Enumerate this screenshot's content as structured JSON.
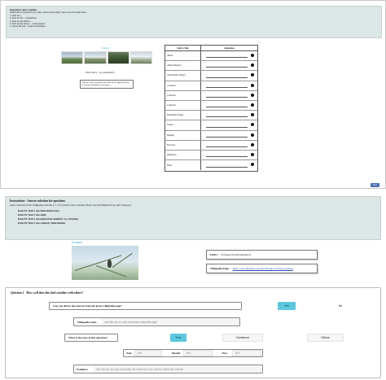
{
  "top": {
    "instr_title": "Instructions: select a question",
    "instr_sub": "Which kind of question do you want to ask about the entity? Select one of the Tasks below.",
    "instr_items": [
      "1. Don't use ...",
      "2. Don't use the ... visualization",
      "3. Don't use the infobox ...",
      "4. Don't use the answer ... at this question",
      "5. Choose the task ... based on the images ..."
    ],
    "gallery_label": "Gallery",
    "caption": "What is this a ... (Lowlands Bird) ...",
    "note": "Pick one of the questions in the table on the right and answer it with the information on the page ...",
    "table_head": [
      "Select a Task",
      "Annotation"
    ],
    "tasks": [
      "Album",
      "Album Subgenre",
      "Characteristic (Stage)",
      "Calculator",
      "Collection",
      "Collection",
      "Established (Stage)",
      "Gender",
      "Heading",
      "First Area",
      "Dimension",
      "Home"
    ],
    "next_label": "Next"
  },
  "bottom": {
    "instr_title": "Instructions - Answer selection for questions",
    "instr_sub": "select answers from Wikipedia articles (<= 10 words); short answers Don't use information box and Category!",
    "items": [
      "Item #1: Don't use information box",
      "Item #2: Don't use table",
      "Item #3: Don't use numerical numbers to a bracket",
      "Item #4: Don't use category information"
    ],
    "entity_section_label": "Images",
    "entity_label": "Entity :",
    "entity_value": "(Orange fronted parakeet)",
    "wiki_label": "Wikipedia Page :",
    "wiki_url": "https://en.wikipedia.org/wiki/Orange-fronted_parakeet",
    "question_title": "Question 1 - How well does this bird socialize with others?",
    "derive_label": "Can you derive the answer from the given wikipedia page?",
    "yes_label": "Yes",
    "no_label": "No",
    "wiki_link_label": "Wikipedia Link:",
    "wiki_link_placeholder": "use this box to copy and paste wikipedia page",
    "type_label": "What is the type of this question?",
    "type_options": [
      "Time",
      "Numerical",
      "Others"
    ],
    "year_label": "Year:",
    "month_label": "Month:",
    "day_label": "Day:",
    "na": "N/A",
    "evidence_label": "Evidence:",
    "evidence_placeholder": "use this box to copy and paste the sentences you used to derive the answer"
  },
  "colors": {
    "selected": "#5bc8de",
    "link": "#2a52be",
    "panel": "#dde6e6",
    "next": "#4a6fb8"
  }
}
